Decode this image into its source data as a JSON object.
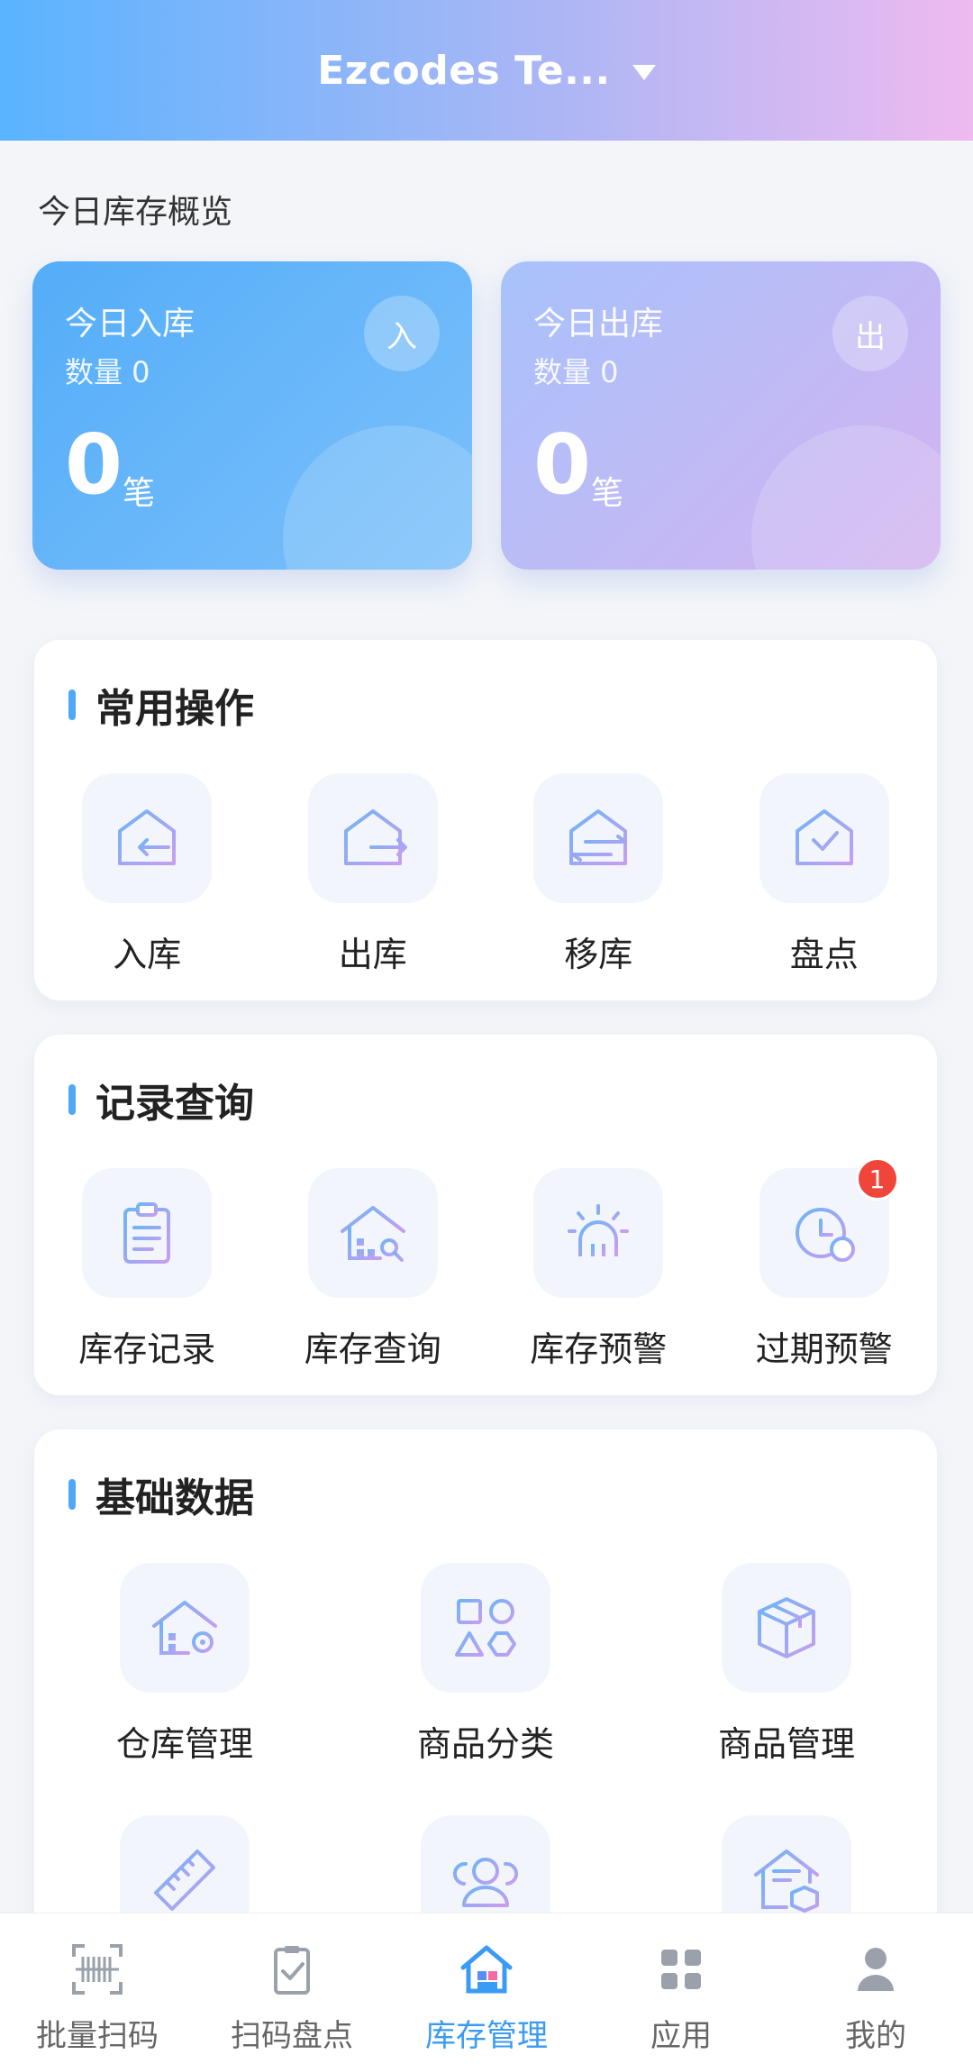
{
  "header": {
    "title": "Ezcodes Te..."
  },
  "overview": {
    "title": "今日库存概览",
    "inbound": {
      "label": "今日入库",
      "quantity": "数量 0",
      "badge": "入",
      "count": "0",
      "unit": "笔"
    },
    "outbound": {
      "label": "今日出库",
      "quantity": "数量 0",
      "badge": "出",
      "count": "0",
      "unit": "笔"
    }
  },
  "common_ops": {
    "title": "常用操作",
    "items": [
      {
        "label": "入库",
        "icon": "inbound-icon"
      },
      {
        "label": "出库",
        "icon": "outbound-icon"
      },
      {
        "label": "移库",
        "icon": "transfer-icon"
      },
      {
        "label": "盘点",
        "icon": "stocktake-icon"
      }
    ]
  },
  "records": {
    "title": "记录查询",
    "items": [
      {
        "label": "库存记录",
        "icon": "clipboard-icon"
      },
      {
        "label": "库存查询",
        "icon": "warehouse-search-icon"
      },
      {
        "label": "库存预警",
        "icon": "alarm-icon"
      },
      {
        "label": "过期预警",
        "icon": "clock-warning-icon",
        "badge": "1"
      }
    ]
  },
  "basic_data": {
    "title": "基础数据",
    "items": [
      {
        "label": "仓库管理",
        "icon": "warehouse-settings-icon"
      },
      {
        "label": "商品分类",
        "icon": "shapes-icon"
      },
      {
        "label": "商品管理",
        "icon": "box-icon"
      },
      {
        "label": "",
        "icon": "ruler-icon"
      },
      {
        "label": "",
        "icon": "users-icon"
      },
      {
        "label": "",
        "icon": "warehouse-package-icon"
      }
    ]
  },
  "bottom_nav": {
    "items": [
      {
        "label": "批量扫码",
        "icon": "barcode-scan-icon"
      },
      {
        "label": "扫码盘点",
        "icon": "clipboard-check-icon"
      },
      {
        "label": "库存管理",
        "icon": "home-inventory-icon",
        "active": true
      },
      {
        "label": "应用",
        "icon": "apps-grid-icon"
      },
      {
        "label": "我的",
        "icon": "user-icon"
      }
    ]
  },
  "colors": {
    "accent": "#3a9bf4",
    "badge_red": "#f0453a"
  }
}
